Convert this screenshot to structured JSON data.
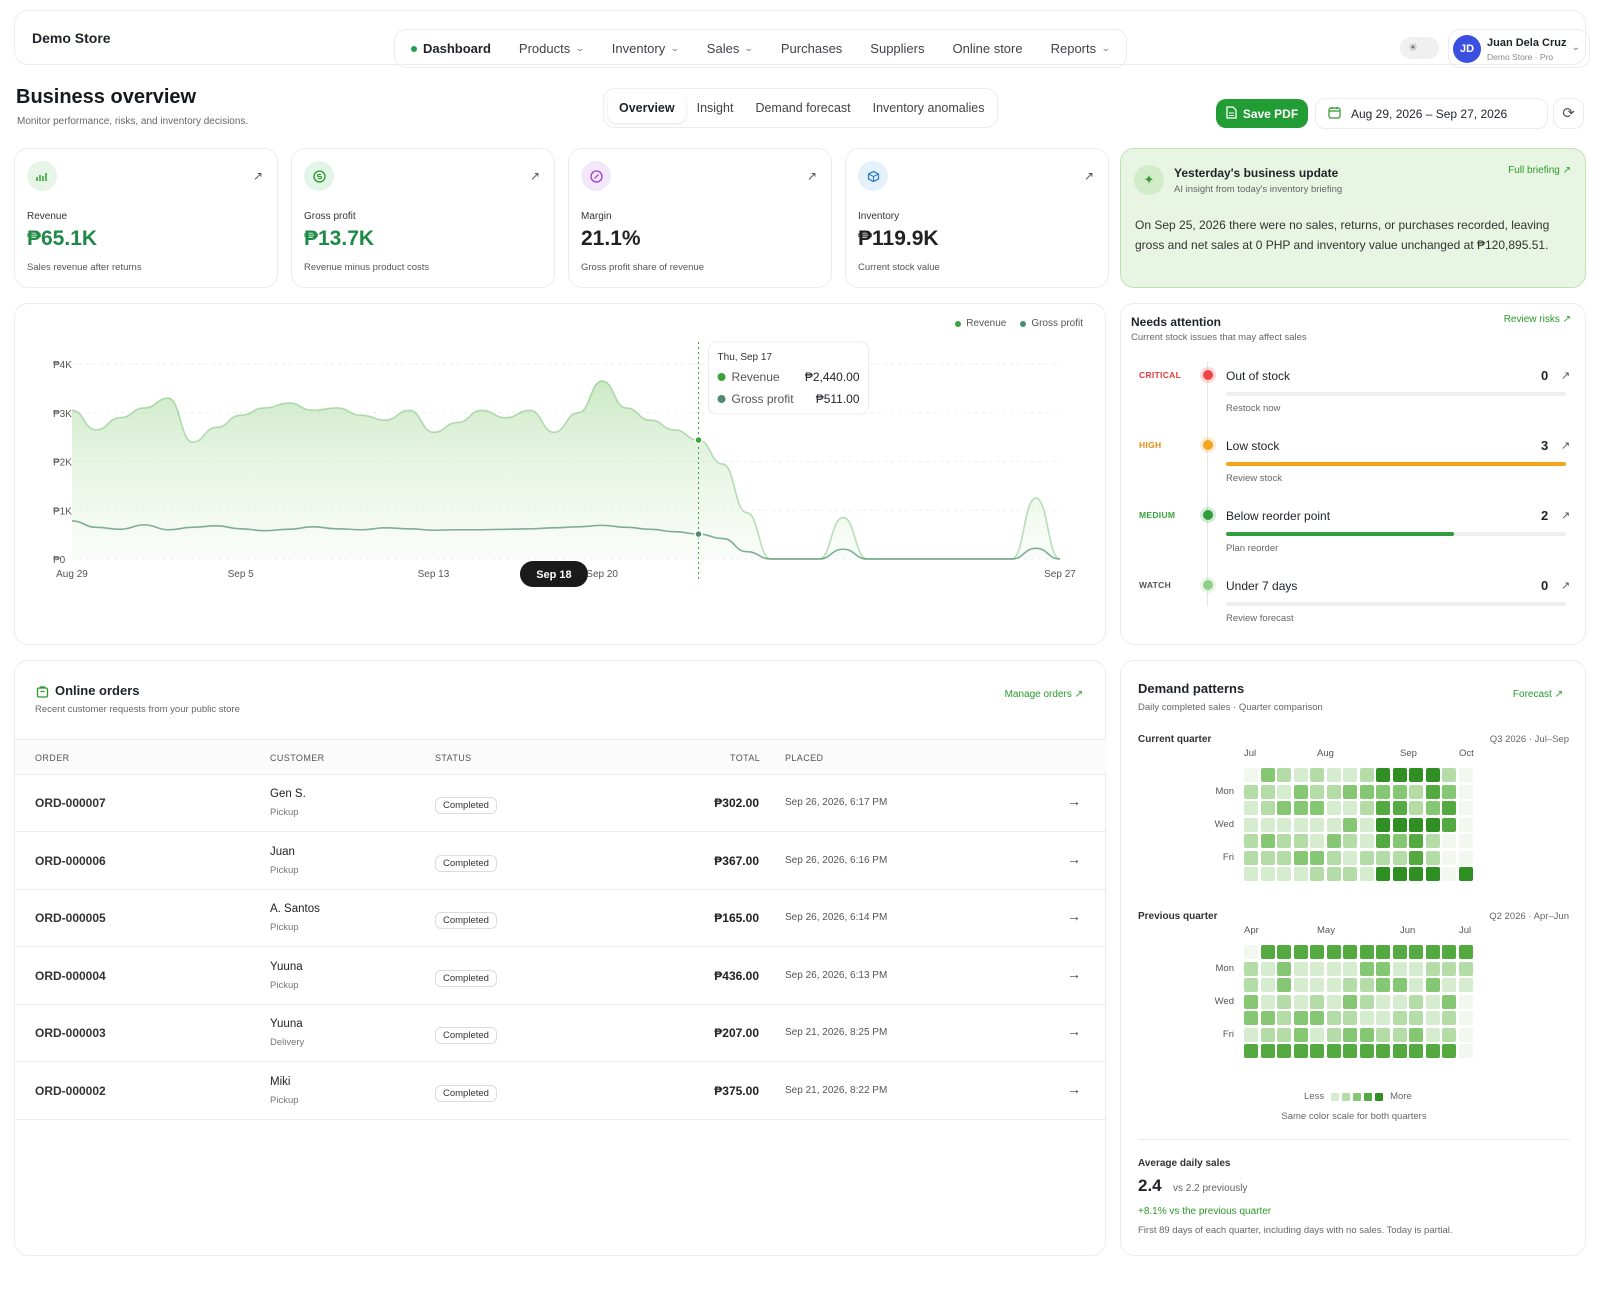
{
  "brand": "Demo Store",
  "nav": [
    {
      "label": "Dashboard",
      "active": true,
      "dropdown": false
    },
    {
      "label": "Products",
      "dropdown": true
    },
    {
      "label": "Inventory",
      "dropdown": true
    },
    {
      "label": "Sales",
      "dropdown": true
    },
    {
      "label": "Purchases",
      "dropdown": false
    },
    {
      "label": "Suppliers",
      "dropdown": false
    },
    {
      "label": "Online store",
      "dropdown": false
    },
    {
      "label": "Reports",
      "dropdown": true
    }
  ],
  "user": {
    "initials": "JD",
    "name": "Juan Dela Cruz",
    "subtitle": "Demo Store · Pro"
  },
  "page": {
    "title": "Business overview",
    "subtitle": "Monitor performance, risks, and inventory decisions."
  },
  "tabs": [
    "Overview",
    "Insight",
    "Demand forecast",
    "Inventory anomalies"
  ],
  "actions": {
    "save_pdf": "Save PDF",
    "date_range": "Aug 29, 2026 – Sep 27, 2026"
  },
  "kpis": [
    {
      "label": "Revenue",
      "value": "₱65.1K",
      "sub": "Sales revenue after returns",
      "color": "#1f8a47",
      "icon_bg": "#e7f5e9",
      "icon": "chart-icon"
    },
    {
      "label": "Gross profit",
      "value": "₱13.7K",
      "sub": "Revenue minus product costs",
      "color": "#1f8a47",
      "icon_bg": "#e3f5e8",
      "icon": "coin-icon"
    },
    {
      "label": "Margin",
      "value": "21.1%",
      "sub": "Gross profit share of revenue",
      "color": "#222222",
      "icon_bg": "#f3e8fa",
      "icon": "percent-icon"
    },
    {
      "label": "Inventory",
      "value": "₱119.9K",
      "sub": "Current stock value",
      "color": "#222222",
      "icon_bg": "#e5f1fb",
      "icon": "box-icon"
    }
  ],
  "update": {
    "title": "Yesterday's business update",
    "subtitle": "AI insight from today's inventory briefing",
    "link": "Full briefing",
    "body": "On Sep 25, 2026 there were no sales, returns, or purchases recorded, leaving gross and net sales at 0 PHP and inventory value unchanged at ₱120,895.51."
  },
  "chart_data": {
    "type": "area",
    "series": [
      {
        "name": "Revenue",
        "color": "#3aa33a",
        "values": [
          3050,
          2650,
          2900,
          3100,
          3300,
          2400,
          2700,
          2950,
          3100,
          3200,
          3050,
          3100,
          2950,
          2850,
          3050,
          2600,
          2800,
          3050,
          2900,
          3050,
          2600,
          3000,
          3650,
          3100,
          2850,
          2650,
          2440,
          1950,
          950,
          0,
          0,
          0,
          850,
          0,
          0,
          0,
          0,
          0,
          0,
          0,
          1250,
          0
        ]
      },
      {
        "name": "Gross profit",
        "color": "#4c8c6d",
        "values": [
          780,
          650,
          610,
          700,
          600,
          650,
          680,
          620,
          580,
          610,
          660,
          620,
          600,
          640,
          620,
          590,
          600,
          600,
          610,
          620,
          640,
          660,
          690,
          650,
          610,
          560,
          511,
          420,
          150,
          0,
          0,
          0,
          200,
          0,
          0,
          0,
          0,
          0,
          0,
          0,
          220,
          0
        ]
      }
    ],
    "x_ticks": [
      "Aug 29",
      "Sep 5",
      "Sep 13",
      "Sep 18",
      "Sep 20",
      "Sep 27"
    ],
    "y_ticks": [
      "₱0",
      "₱1K",
      "₱2K",
      "₱3K",
      "₱4K"
    ],
    "ylim": [
      0,
      4000
    ],
    "grid": true,
    "legend": "top-right",
    "highlight": {
      "label": "Sep 18",
      "tooltip_date": "Thu, Sep 17",
      "revenue": "₱2,440.00",
      "gross_profit": "₱511.00"
    }
  },
  "attention": {
    "title": "Needs attention",
    "subtitle": "Current stock issues that may affect sales",
    "link": "Review risks",
    "items": [
      {
        "severity": "CRITICAL",
        "name": "Out of stock",
        "count": "0",
        "action": "Restock now",
        "color": "#e33b3b",
        "dot": "#f04545",
        "fill": 0
      },
      {
        "severity": "HIGH",
        "name": "Low stock",
        "count": "3",
        "action": "Review stock",
        "color": "#e58b12",
        "dot": "#f5a21c",
        "fill": 1.0
      },
      {
        "severity": "MEDIUM",
        "name": "Below reorder point",
        "count": "2",
        "action": "Plan reorder",
        "color": "#3aa33a",
        "dot": "#2f9d3a",
        "fill": 0.67
      },
      {
        "severity": "WATCH",
        "name": "Under 7 days",
        "count": "0",
        "action": "Review forecast",
        "color": "#555555",
        "dot": "#8fd088",
        "fill": 0
      }
    ]
  },
  "orders": {
    "title": "Online orders",
    "subtitle": "Recent customer requests from your public store",
    "link": "Manage orders",
    "columns": [
      "ORDER",
      "CUSTOMER",
      "STATUS",
      "TOTAL",
      "PLACED"
    ],
    "rows": [
      {
        "id": "ORD-000007",
        "customer": "Gen S.",
        "method": "Pickup",
        "status": "Completed",
        "total": "₱302.00",
        "placed": "Sep 26, 2026, 6:17 PM"
      },
      {
        "id": "ORD-000006",
        "customer": "Juan",
        "method": "Pickup",
        "status": "Completed",
        "total": "₱367.00",
        "placed": "Sep 26, 2026, 6:16 PM"
      },
      {
        "id": "ORD-000005",
        "customer": "A. Santos",
        "method": "Pickup",
        "status": "Completed",
        "total": "₱165.00",
        "placed": "Sep 26, 2026, 6:14 PM"
      },
      {
        "id": "ORD-000004",
        "customer": "Yuuna",
        "method": "Pickup",
        "status": "Completed",
        "total": "₱436.00",
        "placed": "Sep 26, 2026, 6:13 PM"
      },
      {
        "id": "ORD-000003",
        "customer": "Yuuna",
        "method": "Delivery",
        "status": "Completed",
        "total": "₱207.00",
        "placed": "Sep 21, 2026, 8:25 PM"
      },
      {
        "id": "ORD-000002",
        "customer": "Miki",
        "method": "Pickup",
        "status": "Completed",
        "total": "₱375.00",
        "placed": "Sep 21, 2026, 8:22 PM"
      }
    ]
  },
  "demand": {
    "title": "Demand patterns",
    "subtitle": "Daily completed sales · Quarter comparison",
    "link": "Forecast",
    "current": {
      "label": "Current quarter",
      "range": "Q3 2026 · Jul–Sep",
      "months": [
        "Jul",
        "Aug",
        "Sep",
        "Oct"
      ]
    },
    "previous": {
      "label": "Previous quarter",
      "range": "Q2 2026 · Apr–Jun",
      "months": [
        "Apr",
        "May",
        "Jun",
        "Jul"
      ]
    },
    "days": [
      "Mon",
      "Wed",
      "Fri"
    ],
    "palette": [
      "#f2f7f0",
      "#d6ecce",
      "#b4dca6",
      "#86c774",
      "#54a940",
      "#2f8f22"
    ],
    "legend_less": "Less",
    "legend_more": "More",
    "note": "Same color scale for both quarters",
    "avg_label": "Average daily sales",
    "avg_value": "2.4",
    "avg_prev": "vs 2.2 previously",
    "avg_change": "+8.1% vs the previous quarter",
    "avg_note": "First 89 days of each quarter, including days with no sales. Today is partial."
  }
}
